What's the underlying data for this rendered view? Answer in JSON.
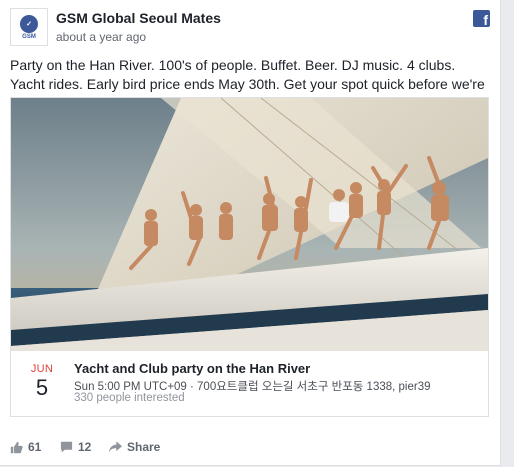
{
  "post": {
    "page_name": "GSM Global Seoul Mates",
    "timestamp": "about a year ago",
    "avatar_text": "GSM",
    "text": "Party on the Han River. 100's of people. Buffet. Beer. DJ music. 4 clubs. Yacht rides. Early bird price ends May 30th. Get your spot quick before we're out!"
  },
  "event": {
    "month": "JUN",
    "day": "5",
    "title": "Yacht and Club party on the Han River",
    "meta": "Sun 5:00 PM UTC+09 · 700요트클럽 오는길 서초구 반포동 1338, pier39",
    "interested": "330 people interested"
  },
  "footer": {
    "likes": "61",
    "comments": "12",
    "share_label": "Share"
  },
  "colors": {
    "brand": "#3b5998",
    "month_red": "#e0413a"
  },
  "icons": [
    "facebook-icon",
    "like-icon",
    "comment-icon",
    "share-icon"
  ]
}
